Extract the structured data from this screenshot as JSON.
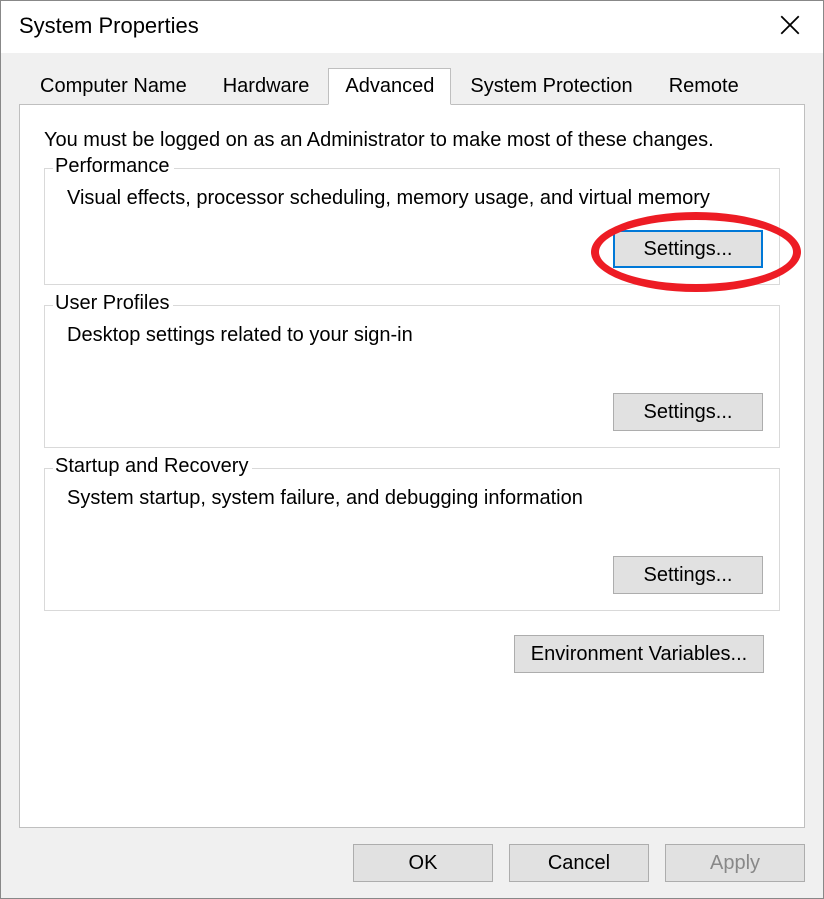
{
  "window": {
    "title": "System Properties"
  },
  "tabs": {
    "computer_name": "Computer Name",
    "hardware": "Hardware",
    "advanced": "Advanced",
    "system_protection": "System Protection",
    "remote": "Remote"
  },
  "panel": {
    "intro": "You must be logged on as an Administrator to make most of these changes.",
    "performance": {
      "legend": "Performance",
      "desc": "Visual effects, processor scheduling, memory usage, and virtual memory",
      "settings_label": "Settings..."
    },
    "user_profiles": {
      "legend": "User Profiles",
      "desc": "Desktop settings related to your sign-in",
      "settings_label": "Settings..."
    },
    "startup_recovery": {
      "legend": "Startup and Recovery",
      "desc": "System startup, system failure, and debugging information",
      "settings_label": "Settings..."
    },
    "env_vars_label": "Environment Variables..."
  },
  "buttons": {
    "ok": "OK",
    "cancel": "Cancel",
    "apply": "Apply"
  }
}
